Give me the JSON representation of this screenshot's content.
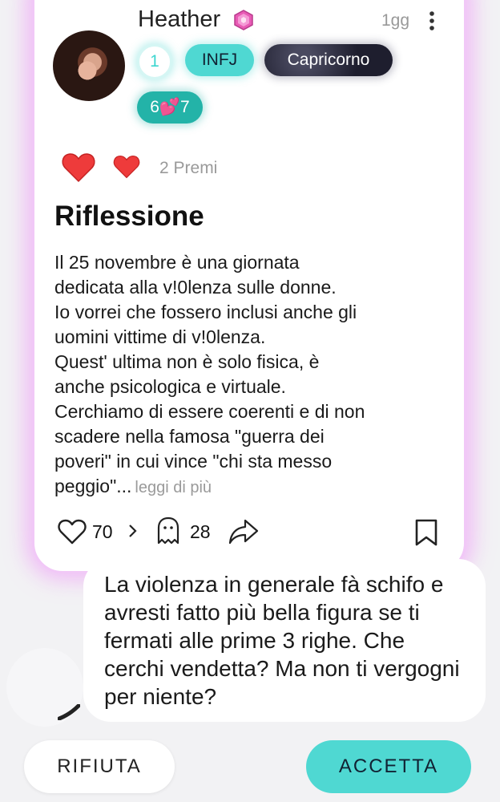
{
  "post": {
    "author": {
      "name": "Heather",
      "badge_icon": "gem-icon",
      "level": "1",
      "mbti": "INFJ",
      "zodiac": "Capricorno",
      "count_badge": "6💕7"
    },
    "time": "1gg",
    "awards_label": "2 Premi",
    "title": "Riflessione",
    "body_lines": [
      "Il 25 novembre è una giornata",
      "dedicata alla v!0lenza sulle donne.",
      "Io vorrei che fossero inclusi anche gli",
      "uomini vittime di v!0lenza.",
      "Quest' ultima non è solo fisica, è",
      "anche psicologica e virtuale.",
      "Cerchiamo di essere coerenti e di non",
      "scadere nella famosa \"guerra dei",
      "poveri\" in cui vince \"chi sta messo",
      "peggio\"..."
    ],
    "read_more": "leggi di più",
    "likes": "70",
    "comments": "28"
  },
  "comment_bubble": {
    "text": "La violenza in generale fà schifo e avresti fatto più bella figura se ti fermati alle prime 3 righe. Che cerchi vendetta? Ma non ti vergogni per niente?"
  },
  "actions": {
    "reject": "RIFIUTA",
    "accept": "ACCETTA"
  },
  "colors": {
    "accent": "#4fd8d2",
    "card_glow": "#ee8cf8",
    "heart": "#ee3b3b"
  }
}
